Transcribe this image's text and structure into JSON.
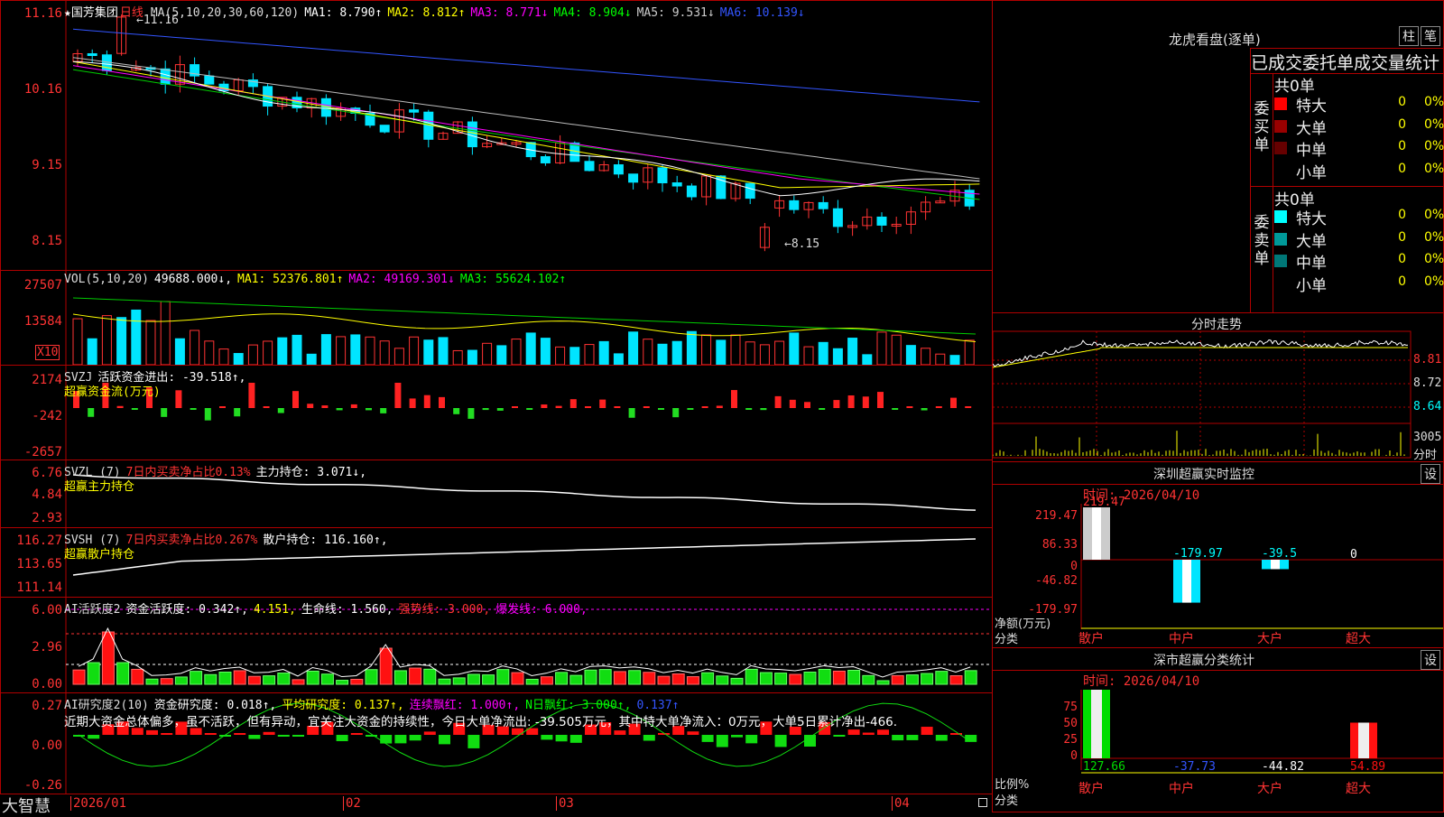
{
  "main": {
    "title": "★国芳集团",
    "period": "日线",
    "ma_label": "MA(5,10,20,30,60,120)",
    "ma": [
      {
        "label": "MA1: 8.790↑",
        "color": "#ffffff"
      },
      {
        "label": "MA2: 8.812↑",
        "color": "#ffff00"
      },
      {
        "label": "MA3: 8.771↓",
        "color": "#ff00ff"
      },
      {
        "label": "MA4: 8.904↓",
        "color": "#00ff00"
      },
      {
        "label": "MA5: 9.531↓",
        "color": "#cccccc"
      },
      {
        "label": "MA6: 10.139↓",
        "color": "#3355ff"
      }
    ],
    "axis": [
      "11.16",
      "10.16",
      "9.15",
      "8.15"
    ],
    "high_label": "11.16",
    "low_label": "8.15"
  },
  "vol": {
    "header": "VOL(5,10,20)",
    "value": "49688.000↓,",
    "ma": [
      {
        "label": "MA1: 52376.801↑",
        "color": "#ffff00"
      },
      {
        "label": "MA2: 49169.301↓",
        "color": "#ff00ff"
      },
      {
        "label": "MA3: 55624.102↑",
        "color": "#00ff00"
      }
    ],
    "axis": [
      "27507",
      "13584"
    ],
    "unit": "X10"
  },
  "svzj": {
    "header": "SVZJ",
    "label": "活跃资金进出: -39.518↑,",
    "sub": "超赢资金流(万元)",
    "axis": [
      "2174",
      "-242",
      "-2657"
    ]
  },
  "svzl": {
    "header": "SVZL (7)",
    "red": "7日内买卖净占比0.13%",
    "label": "主力持仓: 3.071↓,",
    "sub": "超赢主力持仓",
    "axis": [
      "6.76",
      "4.84",
      "2.93"
    ]
  },
  "svsh": {
    "header": "SVSH (7)",
    "red": "7日内买卖净占比0.267%",
    "label": "散户持仓: 116.160↑,",
    "sub": "超赢散户持仓",
    "axis": [
      "116.27",
      "113.65",
      "111.14"
    ]
  },
  "ai1": {
    "header": "AI活跃度2",
    "parts": [
      {
        "t": "资金活跃度: 0.342↑,",
        "c": "#ffffff"
      },
      {
        "t": "4.151,",
        "c": "#ffff00"
      },
      {
        "t": "生命线: 1.560,",
        "c": "#ffffff"
      },
      {
        "t": "强势线: 3.000,",
        "c": "#ff3333"
      },
      {
        "t": "爆发线: 6.000,",
        "c": "#ff00ff"
      }
    ],
    "axis": [
      "6.00",
      "2.96",
      "0.00"
    ]
  },
  "ai2": {
    "header": "AI研究度2(10)",
    "parts": [
      {
        "t": "资金研究度: 0.018↑,",
        "c": "#ffffff"
      },
      {
        "t": "平均研究度: 0.137↑,",
        "c": "#ffff00"
      },
      {
        "t": "连续飘红: 1.000↑,",
        "c": "#ff00ff"
      },
      {
        "t": "N日飘红: 3.000↑,",
        "c": "#00ff00"
      },
      {
        "t": "0.137↑",
        "c": "#3355ff"
      }
    ],
    "comment": "近期大资金总体偏多，虽不活跃，但有异动，宜关注大资金的持续性，今日大单净流出: -39.505万元，其中特大单净流入：0万元，大单5日累计净出-466.",
    "axis": [
      "0.27",
      "0.00",
      "-0.26"
    ]
  },
  "bottom": {
    "brand": "大智慧",
    "dates": [
      "2026/01",
      "02",
      "03",
      "04"
    ]
  },
  "dragon": {
    "title": "龙虎看盘(逐单)",
    "btn1": "柱",
    "btn2": "笔",
    "subtitle": "已成交委托单成交量统计",
    "buy_side": "委买单",
    "sell_side": "委卖单",
    "buy_total": "共0单",
    "sell_total": "共0单",
    "buy_rows": [
      {
        "label": "特大",
        "n": "0",
        "p": "0%",
        "color": "#ff0000"
      },
      {
        "label": "大单",
        "n": "0",
        "p": "0%",
        "color": "#990000"
      },
      {
        "label": "中单",
        "n": "0",
        "p": "0%",
        "color": "#660000"
      },
      {
        "label": "小单",
        "n": "0",
        "p": "0%",
        "color": "#000000"
      }
    ],
    "sell_rows": [
      {
        "label": "特大",
        "n": "0",
        "p": "0%",
        "color": "#00ffff"
      },
      {
        "label": "大单",
        "n": "0",
        "p": "0%",
        "color": "#009999"
      },
      {
        "label": "中单",
        "n": "0",
        "p": "0%",
        "color": "#007777"
      },
      {
        "label": "小单",
        "n": "0",
        "p": "0%",
        "color": "#000000"
      }
    ]
  },
  "intraday": {
    "title": "分时走势",
    "axis": [
      "8.81",
      "8.72",
      "8.64"
    ],
    "vol_label": "3005",
    "vol_unit": "分时"
  },
  "monitor": {
    "title": "深圳超赢实时监控",
    "btn": "设",
    "time": "时间: 2026/04/10",
    "axis": [
      "219.47",
      "86.33",
      "0",
      "-46.82",
      "-179.97"
    ],
    "unit": "净额(万元)",
    "cat_label": "分类",
    "categories": [
      "散户",
      "中户",
      "大户",
      "超大"
    ],
    "values": [
      "219.47",
      "-179.97",
      "-39.5",
      "0"
    ]
  },
  "classify": {
    "title": "深市超赢分类统计",
    "btn": "设",
    "time": "时间: 2026/04/10",
    "axis": [
      "75",
      "50",
      "25",
      "0"
    ],
    "unit": "比例%",
    "cat_label": "分类",
    "categories": [
      "散户",
      "中户",
      "大户",
      "超大"
    ],
    "values": [
      "127.66",
      "-37.73",
      "-44.82",
      "54.89"
    ]
  },
  "chart_data": {
    "type": "bar",
    "categories": [
      "散户",
      "中户",
      "大户",
      "超大"
    ],
    "values": [
      219.47,
      -179.97,
      -39.5,
      0
    ],
    "title": "深圳超赢实时监控",
    "ylabel": "净额(万元)",
    "ylim": [
      -179.97,
      219.47
    ]
  }
}
